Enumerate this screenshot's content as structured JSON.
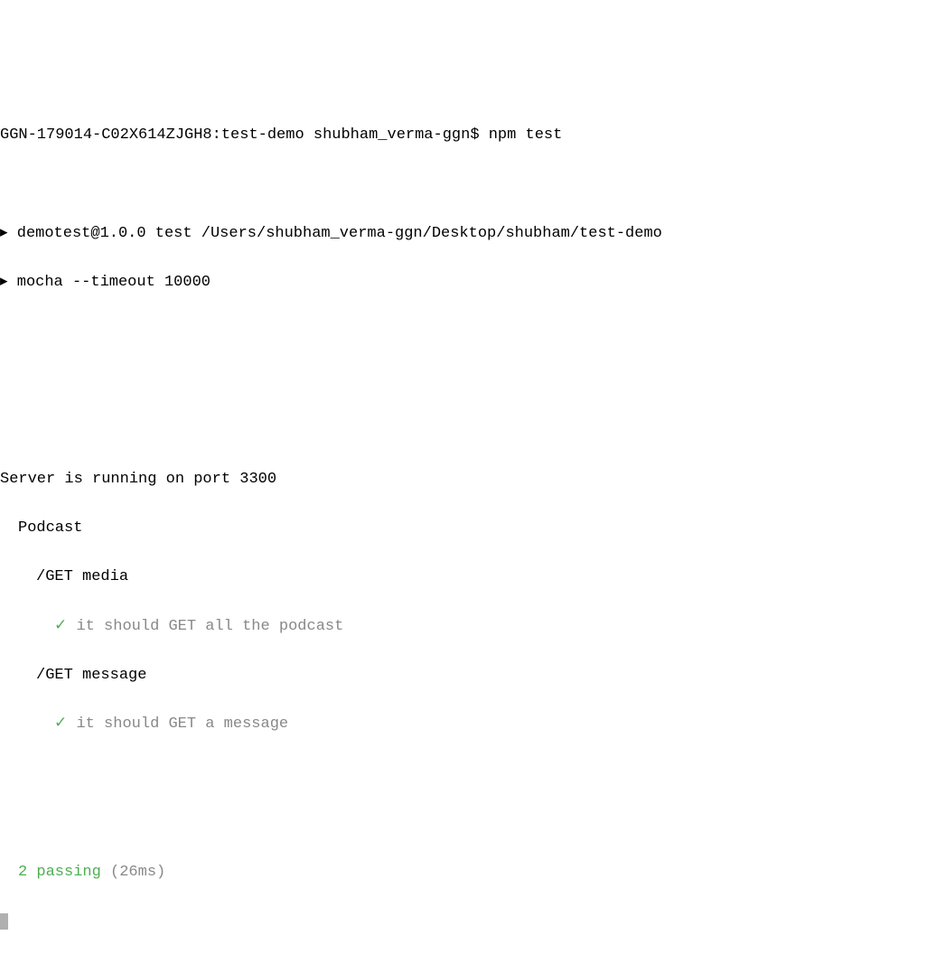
{
  "prompt": {
    "host": "GGN-179014-C02X614ZJGH8",
    "path": "test-demo",
    "user": "shubham_verma-ggn",
    "symbol": "$",
    "command": "npm test"
  },
  "npm": {
    "bullet": "▸",
    "line1": "demotest@1.0.0 test /Users/shubham_verma-ggn/Desktop/shubham/test-demo",
    "line2": "mocha --timeout 10000"
  },
  "server": {
    "message": "Server is running on port 3300"
  },
  "mocha": {
    "suite": "Podcast",
    "groups": [
      {
        "name": "/GET media",
        "tests": [
          {
            "check": "✓",
            "desc": "it should GET all the podcast"
          }
        ]
      },
      {
        "name": "/GET message",
        "tests": [
          {
            "check": "✓",
            "desc": "it should GET a message"
          }
        ]
      }
    ],
    "summary": {
      "passing": "2 passing",
      "time": "(26ms)"
    }
  }
}
